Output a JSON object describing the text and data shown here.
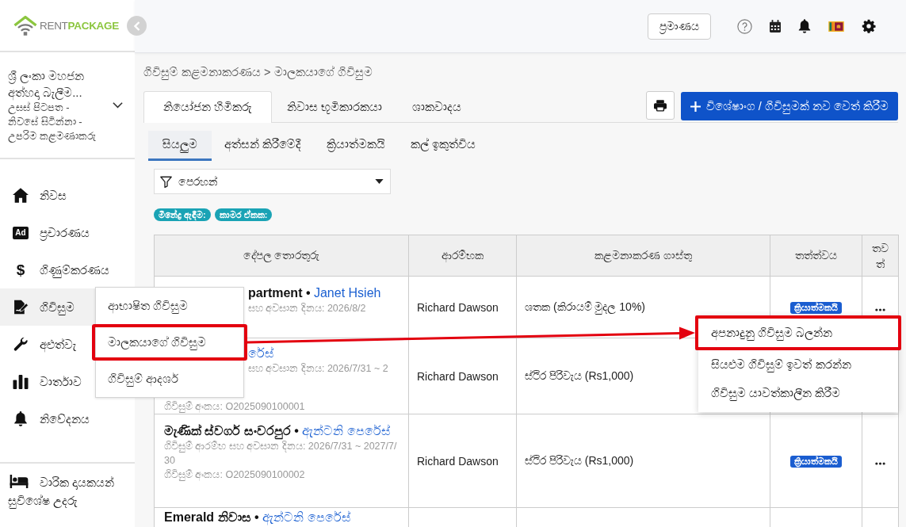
{
  "sidebar": {
    "logo": {
      "word_start": "RENT",
      "word_end": "PACKAGE"
    },
    "account": {
      "name": "ශ්‍රී ලංකා මහජන අත්හදා බැලීම...",
      "role": "උසස් පිටපත - නිවසේ සිටින්නා - උපරිම කළමණාකරු"
    },
    "nav_items": [
      {
        "label": "නිවස",
        "selected": false
      },
      {
        "label": "ප්‍රචාරණය",
        "icon_text": "Ad",
        "selected": false
      },
      {
        "label": "ගිණුම්කරණය",
        "icon_text": "$",
        "selected": false
      },
      {
        "label": "ගිවිසුම",
        "selected": true
      },
      {
        "label": "අළුත්වැ",
        "selected": false
      },
      {
        "label": "වාර්තාව",
        "selected": false
      },
      {
        "label": "නිවේදනය",
        "selected": false
      }
    ],
    "footer_item": {
      "label": "වාරික දායකයන් සුවිශේෂ උදරු"
    }
  },
  "submenu": {
    "items": [
      {
        "label": "ආභාෂිත ගිවිසුම",
        "highlighted": false
      },
      {
        "label": "මාලකයාගේ ගිවිසුම",
        "highlighted": true
      },
      {
        "label": "ගිවිසුම් ආදර්ශ",
        "highlighted": false
      }
    ]
  },
  "header": {
    "size_button": "ප්‍රමාණය"
  },
  "breadcrumb": "ගිවිසුම් කළමනාකරණය > මාලකයාගේ ගිවිසුම",
  "tabs": [
    {
      "label": "නියෝජන හිමිකරු",
      "selected": true
    },
    {
      "label": "නිවාස භූමිකාරකයා",
      "selected": false
    },
    {
      "label": "ශාකවාදය",
      "selected": false
    }
  ],
  "add_button": "විශේෂාංග / ගිවිසුමක් නව වෙත් කිරීම",
  "status_tabs": [
    {
      "label": "සියලුම",
      "selected": true
    },
    {
      "label": "අත්සන් කිරීමේදී",
      "selected": false
    },
    {
      "label": "ක්‍රියාත්මකයි",
      "selected": false
    },
    {
      "label": "කල් ඉකුත්විය",
      "selected": false
    }
  ],
  "filter": {
    "placeholder": "පෙරහන්"
  },
  "filter_tags": [
    "මිනේද්‍ර ඇඳීම:",
    "කාමර ඒකක:"
  ],
  "table": {
    "columns": [
      "දේපල තොරතුරු",
      "ආරම්භක",
      "කළමනාකරණ ගාස්තු",
      "තත්ත්වය",
      "තවත්"
    ],
    "rows": [
      {
        "property": "partment •",
        "owner": "Janet Hsieh",
        "dates": "සහ අවසාන දිනය: 2026/8/2",
        "starter": "Richard Dawson",
        "fee": "ශතක (කිරායම් මුදල 10%)",
        "status": "ක්‍රියාත්මකයි"
      },
      {
        "owner": "රේස්",
        "dates": "සහ අවසාන දිනය: 2026/7/31 ~ 2",
        "contract_no": "ගිවිසුම් අංකය: O2025090100001",
        "starter": "Richard Dawson",
        "fee": "ස්ථිර පිරිවැය (Rs1,000)"
      },
      {
        "property": "මැණික් ස්වර්ග සංවරපුර •",
        "owner": "ඇන්ටනි පෙරේස්",
        "dates": "ගිවිසුම් ආරම්භ සහ අවසාන දිනය: 2026/7/31 ~ 2027/7/30",
        "contract_no": "ගිවිසුම් අංකය: O2025090100002",
        "starter": "Richard Dawson",
        "fee": "ස්ථිර පිරිවැය (Rs1,000)",
        "status": "ක්‍රියාත්මකයි"
      },
      {
        "property": "Emerald නිවාස •",
        "owner": "ඇන්ටනි පෙරේස්"
      }
    ]
  },
  "row_menu": {
    "items": [
      {
        "label": "අපනාදුනු ගිවිසුම බලන්න",
        "highlighted": true
      },
      {
        "label": "සියළුම ගිවිසුම් ඉවත් කරන්න",
        "highlighted": false
      },
      {
        "label": "ගිවිසුම යාවත්කාලීන කිරීම",
        "highlighted": false
      }
    ]
  }
}
